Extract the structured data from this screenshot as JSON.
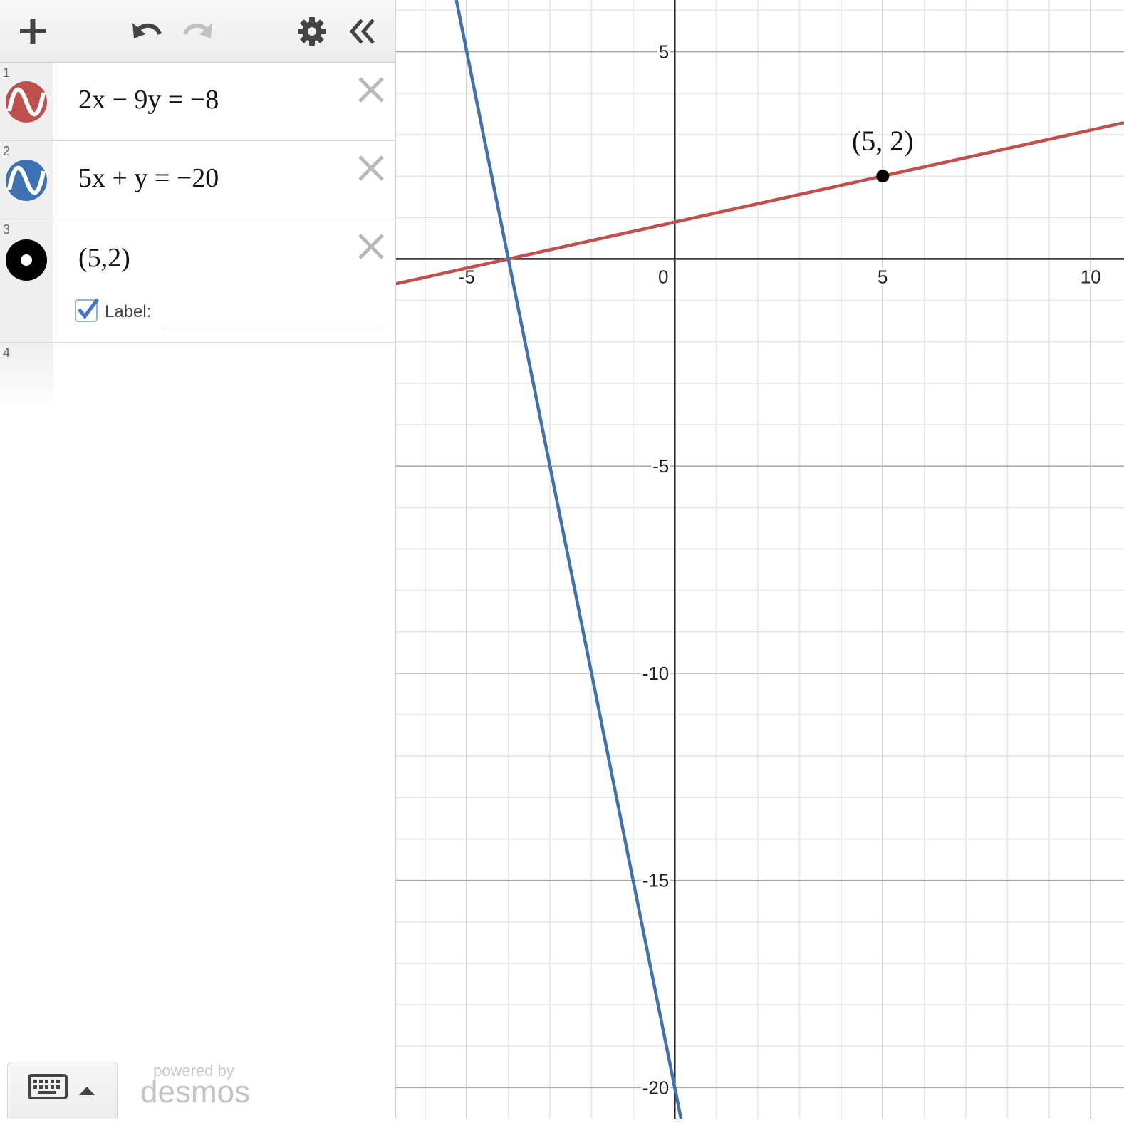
{
  "toolbar": {
    "add_icon": "plus-icon",
    "undo_icon": "undo-icon",
    "redo_icon": "redo-icon",
    "settings_icon": "gear-icon",
    "collapse_icon": "double-chevron-left-icon"
  },
  "expressions": [
    {
      "index": "1",
      "latex": "2x − 9y = −8",
      "color": "#c0504d",
      "icon": "wave-icon"
    },
    {
      "index": "2",
      "latex": "5x + y = −20",
      "color": "#3f72b3",
      "icon": "wave-icon"
    },
    {
      "index": "3",
      "latex": "(5,2)",
      "color": "#000000",
      "icon": "point-icon",
      "label_checkbox_label": "Label:",
      "label_checked": true,
      "label_value": ""
    },
    {
      "index": "4",
      "latex": ""
    }
  ],
  "keyboard": {
    "icon": "keyboard-icon",
    "toggle_icon": "triangle-up-icon"
  },
  "branding": {
    "powered_by": "powered by",
    "brand": "desmos"
  },
  "chart_data": {
    "type": "line",
    "xlim": [
      -6.7,
      10.8
    ],
    "ylim": [
      -20.75,
      6.25
    ],
    "x_ticks": [
      -5,
      0,
      5,
      10
    ],
    "x_tick_labels": [
      "-5",
      "0",
      "5",
      "10"
    ],
    "y_ticks": [
      5,
      -5,
      -10,
      -15,
      -20
    ],
    "y_tick_labels": [
      "5",
      "-5",
      "-10",
      "-15",
      "-20"
    ],
    "grid": true,
    "major_grid_step": 5,
    "minor_grid_step": 1,
    "series": [
      {
        "equation": "2x − 9y = −8",
        "a": 2,
        "b": -9,
        "c": -8,
        "color": "#c0504d"
      },
      {
        "equation": "5x + y = −20",
        "a": 5,
        "b": 1,
        "c": -20,
        "color": "#3f72b3"
      }
    ],
    "points": [
      {
        "x": 5,
        "y": 2,
        "label": "(5, 2)",
        "color": "#000000"
      }
    ]
  }
}
